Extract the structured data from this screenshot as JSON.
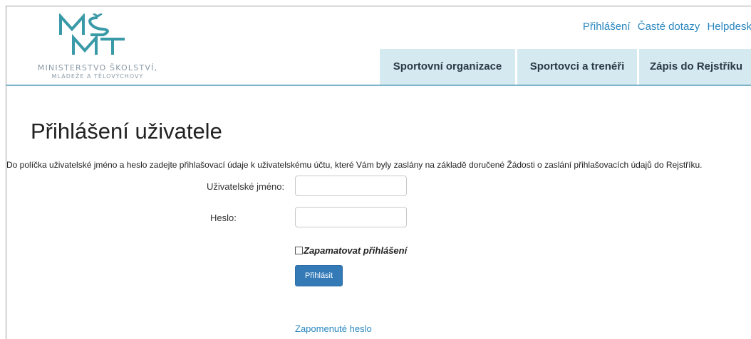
{
  "header": {
    "logo_text_line1": "MINISTERSTVO ŠKOLSTVÍ,",
    "logo_text_line2": "MLÁDEŽE A TĚLOVÝCHOVY",
    "top_links": [
      "Přihlášení",
      "Časté dotazy",
      "Helpdesk"
    ],
    "nav": [
      "Sportovní organizace",
      "Sportovci a trenéři",
      "Zápis do Rejstříku"
    ]
  },
  "main": {
    "title": "Přihlášení uživatele",
    "intro": "Do políčka uživatelské jméno a heslo zadejte přihlašovací údaje k uživatelskému účtu, které Vám byly zaslány na základě doručené Žádosti o zaslání přihlašovacích údajů do Rejstříku.",
    "form": {
      "username_label": "Uživatelské jméno:",
      "username_value": "",
      "password_label": "Heslo:",
      "password_value": "",
      "remember_label": "Zapamatovat přihlášení",
      "remember_checked": false,
      "submit_label": "Přihlásit"
    },
    "forgot_link": "Zapomenuté heslo"
  },
  "colors": {
    "link": "#2a87c0",
    "nav_bg": "#d5e9f1",
    "header_rule": "#7fb3c8",
    "button": "#337ab7",
    "logo_teal": "#3b9aa8"
  }
}
